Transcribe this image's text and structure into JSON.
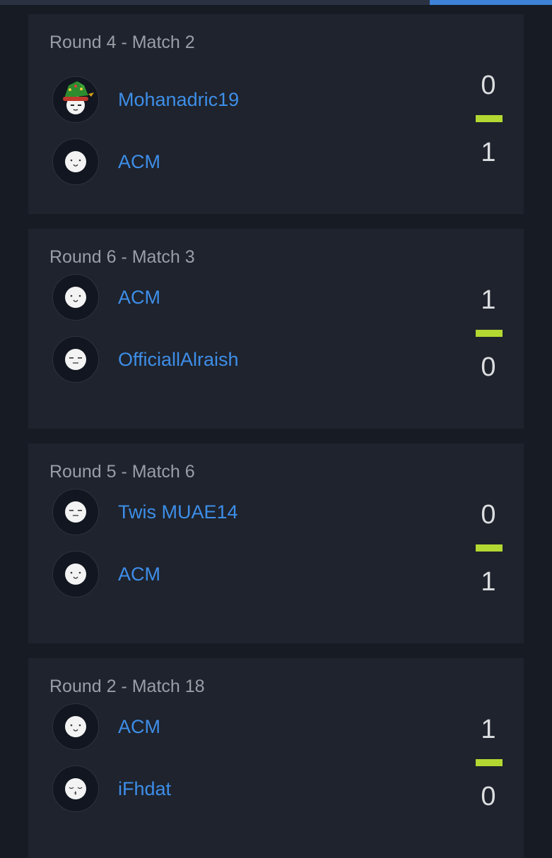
{
  "colors": {
    "background": "#161b24",
    "card": "#1e232d",
    "player_link": "#3e8ee8",
    "winner_bar": "#b4d832",
    "top_accent": "#3d82d6"
  },
  "matches": [
    {
      "title": "Round 4 - Match 2",
      "players": [
        {
          "name": "Mohanadric19",
          "avatar": "elf-hat-face-icon",
          "score": "0"
        },
        {
          "name": "ACM",
          "avatar": "smiling-face-icon",
          "score": "1"
        }
      ]
    },
    {
      "title": "Round 6 - Match 3",
      "players": [
        {
          "name": "ACM",
          "avatar": "smiling-face-icon",
          "score": "1"
        },
        {
          "name": "OfficiallAlraish",
          "avatar": "smirk-face-icon",
          "score": "0"
        }
      ]
    },
    {
      "title": "Round 5 - Match 6",
      "players": [
        {
          "name": "Twis MUAE14",
          "avatar": "smirk-face-icon",
          "score": "0"
        },
        {
          "name": "ACM",
          "avatar": "smiling-face-icon",
          "score": "1"
        }
      ]
    },
    {
      "title": "Round 2 - Match 18",
      "players": [
        {
          "name": "ACM",
          "avatar": "smiling-face-icon",
          "score": "1"
        },
        {
          "name": "iFhdat",
          "avatar": "kiss-face-icon",
          "score": "0"
        }
      ]
    }
  ]
}
